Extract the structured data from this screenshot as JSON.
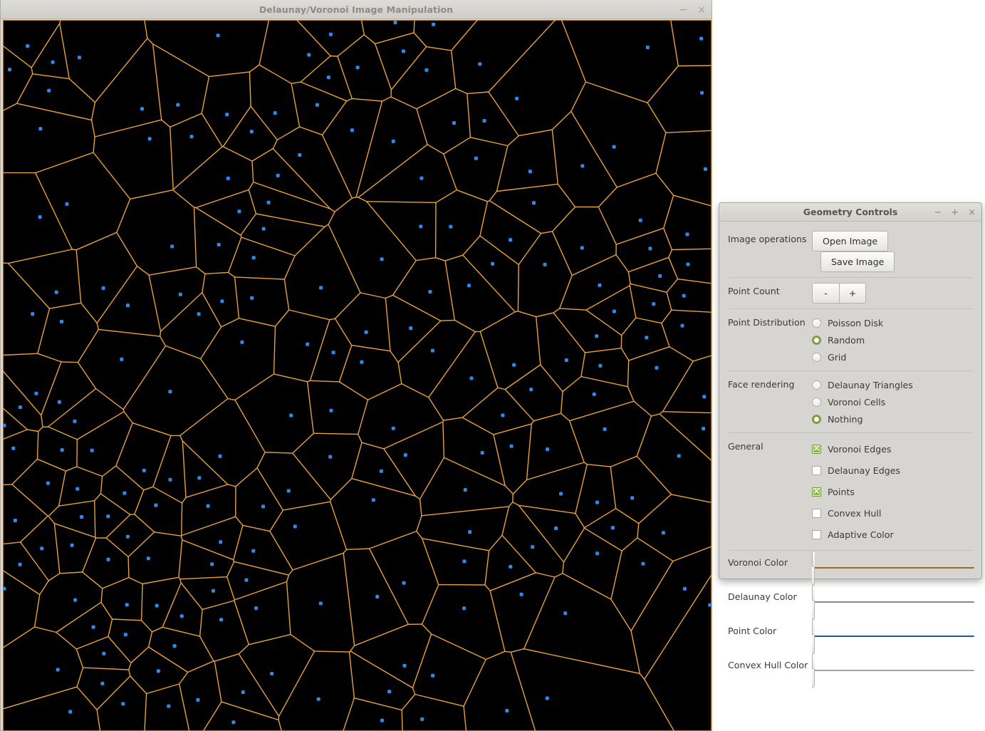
{
  "main_window": {
    "title": "Delaunay/Voronoi Image Manipulation",
    "minimize_label": "−",
    "close_label": "×",
    "canvas": {
      "background_color": "#000000",
      "edge_color": "#e8a23c",
      "point_color": "#2e8bee",
      "point_count": 196
    }
  },
  "dialog": {
    "title": "Geometry Controls",
    "minimize_label": "−",
    "maximize_label": "+",
    "close_label": "×",
    "image_operations": {
      "label": "Image operations",
      "open_label": "Open Image",
      "save_label": "Save Image"
    },
    "point_count": {
      "label": "Point Count",
      "decrement_label": "-",
      "increment_label": "+"
    },
    "point_distribution": {
      "label": "Point Distribution",
      "options": [
        {
          "label": "Poisson Disk",
          "selected": false
        },
        {
          "label": "Random",
          "selected": true
        },
        {
          "label": "Grid",
          "selected": false
        }
      ]
    },
    "face_rendering": {
      "label": "Face rendering",
      "options": [
        {
          "label": "Delaunay Triangles",
          "selected": false
        },
        {
          "label": "Voronoi Cells",
          "selected": false
        },
        {
          "label": "Nothing",
          "selected": true
        }
      ]
    },
    "general": {
      "label": "General",
      "checkboxes": [
        {
          "label": "Voronoi Edges",
          "checked": true
        },
        {
          "label": "Delaunay Edges",
          "checked": false
        },
        {
          "label": "Points",
          "checked": true
        },
        {
          "label": "Convex Hull",
          "checked": false
        },
        {
          "label": "Adaptive Color",
          "checked": false
        }
      ]
    },
    "colors": [
      {
        "label": "Voronoi Color",
        "value": "#f5a12e"
      },
      {
        "label": "Delaunay Color",
        "value": "#d4d6cd"
      },
      {
        "label": "Point Color",
        "value": "#2e8bee"
      },
      {
        "label": "Convex Hull Color",
        "value": "#ffffff"
      }
    ]
  }
}
